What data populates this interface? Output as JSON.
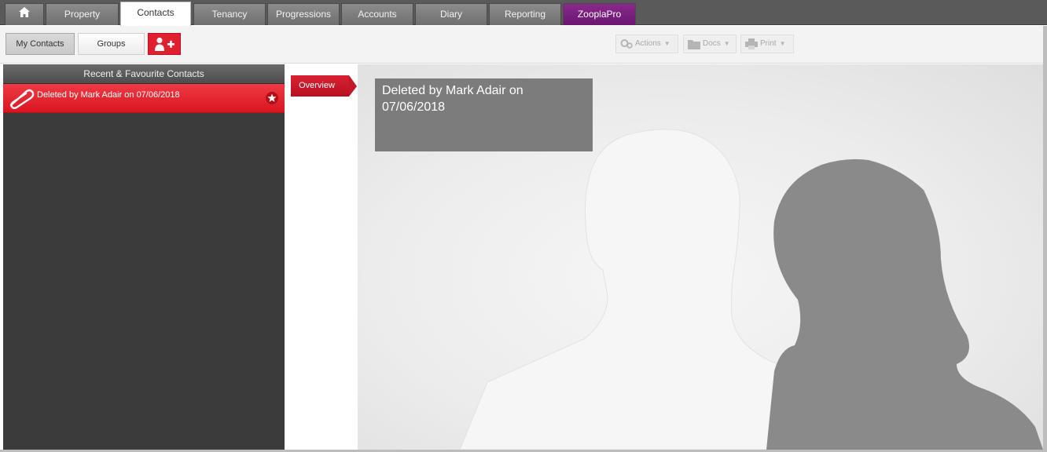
{
  "nav": {
    "home_icon": "home-icon",
    "tabs": [
      {
        "label": "Property"
      },
      {
        "label": "Contacts"
      },
      {
        "label": "Tenancy"
      },
      {
        "label": "Progressions"
      },
      {
        "label": "Accounts"
      },
      {
        "label": "Diary"
      },
      {
        "label": "Reporting"
      },
      {
        "label": "ZooplaPro"
      }
    ],
    "active_tab": "Contacts",
    "zoopla_color": "#7a1f7e"
  },
  "toolbar": {
    "my_contacts_label": "My Contacts",
    "groups_label": "Groups",
    "add_contact_icon": "add-user-icon",
    "actions_label": "Actions",
    "docs_label": "Docs",
    "print_label": "Print"
  },
  "sidebar": {
    "title": "Recent & Favourite Contacts",
    "contacts": [
      {
        "name": "Deleted by Mark Adair on 07/06/2018",
        "icon": "paperclip-icon",
        "favourite_icon": "star-icon"
      }
    ]
  },
  "detail": {
    "overview_tab": "Overview",
    "caption": "Deleted by Mark Adair on 07/06/2018"
  },
  "colors": {
    "accent_red": "#d91b27",
    "nav_gray": "#5a5a5a",
    "sidebar_dark": "#3b3b3b"
  }
}
